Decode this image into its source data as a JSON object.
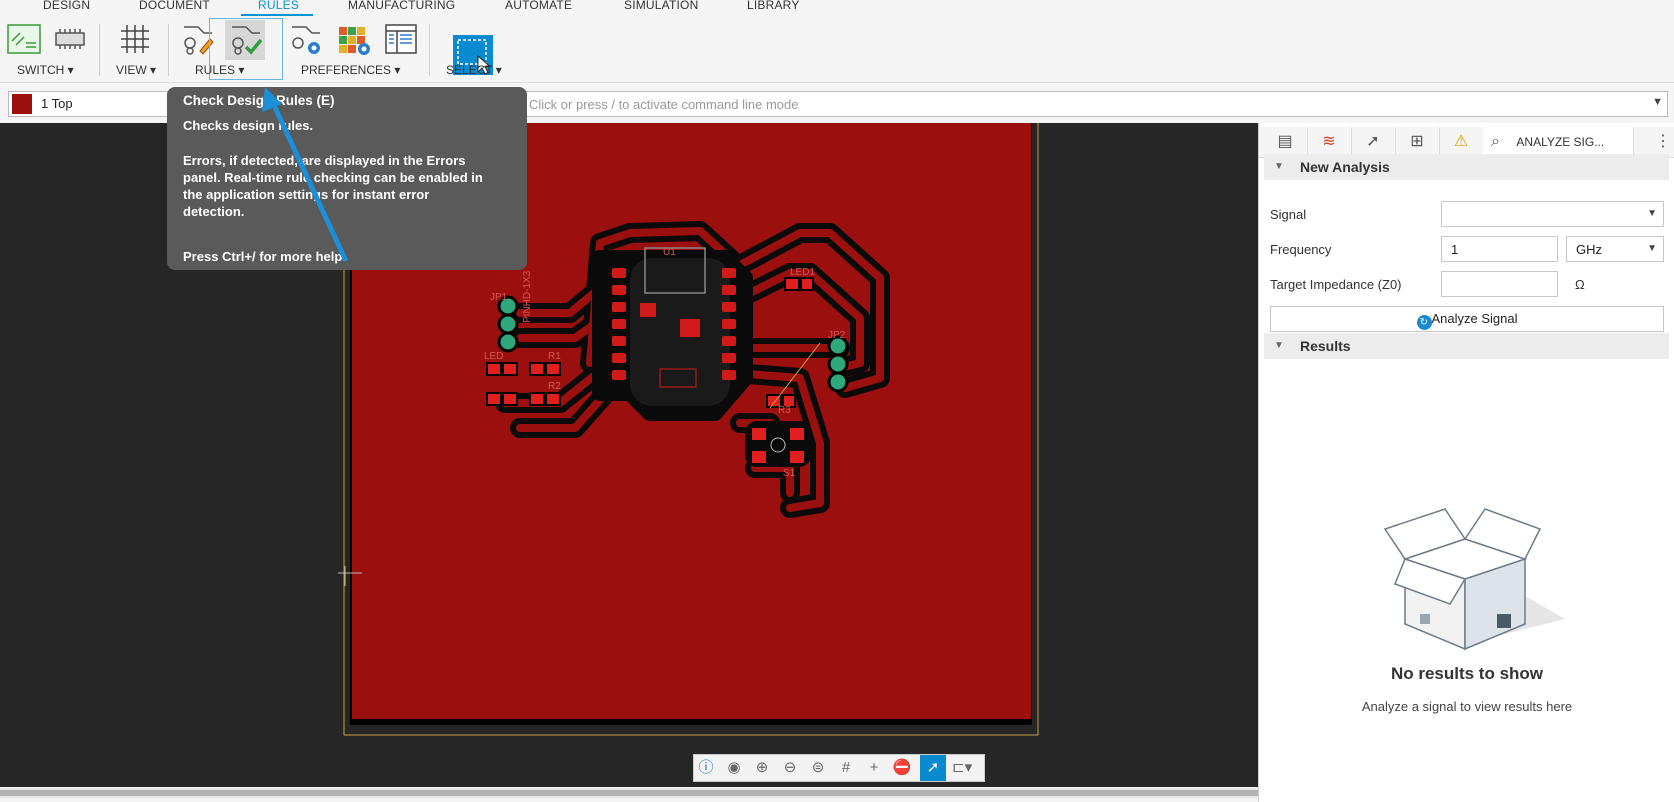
{
  "tabs": [
    "DESIGN",
    "DOCUMENT",
    "RULES",
    "MANUFACTURING",
    "AUTOMATE",
    "SIMULATION",
    "LIBRARY"
  ],
  "ribbon": {
    "groups": [
      "SWITCH",
      "VIEW",
      "RULES",
      "PREFERENCES",
      "SELECT"
    ]
  },
  "command": {
    "layer": "1 Top",
    "layer_color": "#9b0f0f",
    "placeholder": "Click or press / to activate command line mode"
  },
  "tooltip": {
    "title": "Check Design Rules (E)",
    "line1": "Checks design rules.",
    "para1": "Errors, if detected, are displayed in the Errors",
    "para2": "panel. Real-time rule checking can be enabled in",
    "para3": "the application settings for instant error",
    "para4": "detection.",
    "footer": "Press Ctrl+/ for more help."
  },
  "panel": {
    "active_tab": "ANALYZE SIG...",
    "new_analysis": "New Analysis",
    "signal_label": "Signal",
    "signal_value": "",
    "frequency_label": "Frequency",
    "frequency_value": "1",
    "frequency_unit": "GHz",
    "impedance_label": "Target Impedance (Z0)",
    "impedance_value": "",
    "impedance_unit": "Ω",
    "analyze_button": "Analyze Signal",
    "results": "Results",
    "empty_title": "No results to show",
    "empty_sub": "Analyze a signal to view results here"
  },
  "board": {
    "copper_color": "#9b0f0f",
    "labels": [
      "U1",
      "LED1",
      "JP1",
      "JP2",
      "R1",
      "R2",
      "R3",
      "S1",
      "LED",
      "PINHD-1X3"
    ]
  },
  "bottom_toolbar": [
    "info-icon",
    "eye-icon",
    "zoom-in-icon",
    "zoom-out-icon",
    "zoom-fit-icon",
    "grid-icon",
    "crosshair-icon",
    "stop-icon",
    "select-icon",
    "route-icon"
  ]
}
